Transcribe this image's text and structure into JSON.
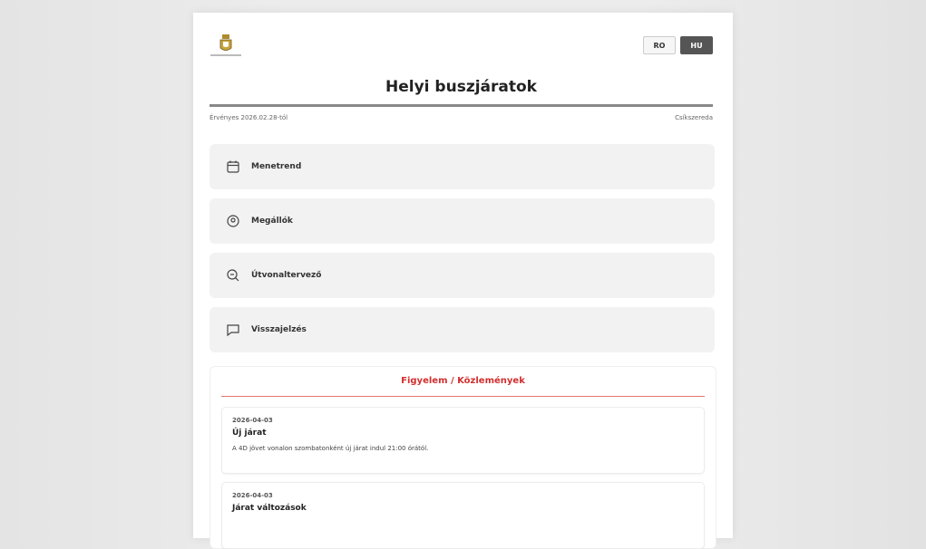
{
  "header": {
    "logo_name": "city-logo",
    "languages": [
      {
        "code": "RO",
        "active": false
      },
      {
        "code": "HU",
        "active": true
      }
    ],
    "title": "Helyi buszjáratok",
    "valid_from": "Érvényes 2026.02.28-tól",
    "city": "Csíkszereda"
  },
  "menu": [
    {
      "label": "Menetrend",
      "icon": "calendar-icon"
    },
    {
      "label": "Megállók",
      "icon": "location-pin-icon"
    },
    {
      "label": "Útvonaltervező",
      "icon": "route-search-icon"
    },
    {
      "label": "Visszajelzés",
      "icon": "feedback-icon"
    }
  ],
  "notices": {
    "title": "Figyelem / Közlemények",
    "accent_color": "#d32f2f",
    "items": [
      {
        "date": "2026-04-03",
        "title": "Új járat",
        "body": "A 4D jövet vonalon szombatonként új járat indul 21:00 órától."
      },
      {
        "date": "2026-04-03",
        "title": "Járat változások",
        "body": ""
      }
    ]
  }
}
